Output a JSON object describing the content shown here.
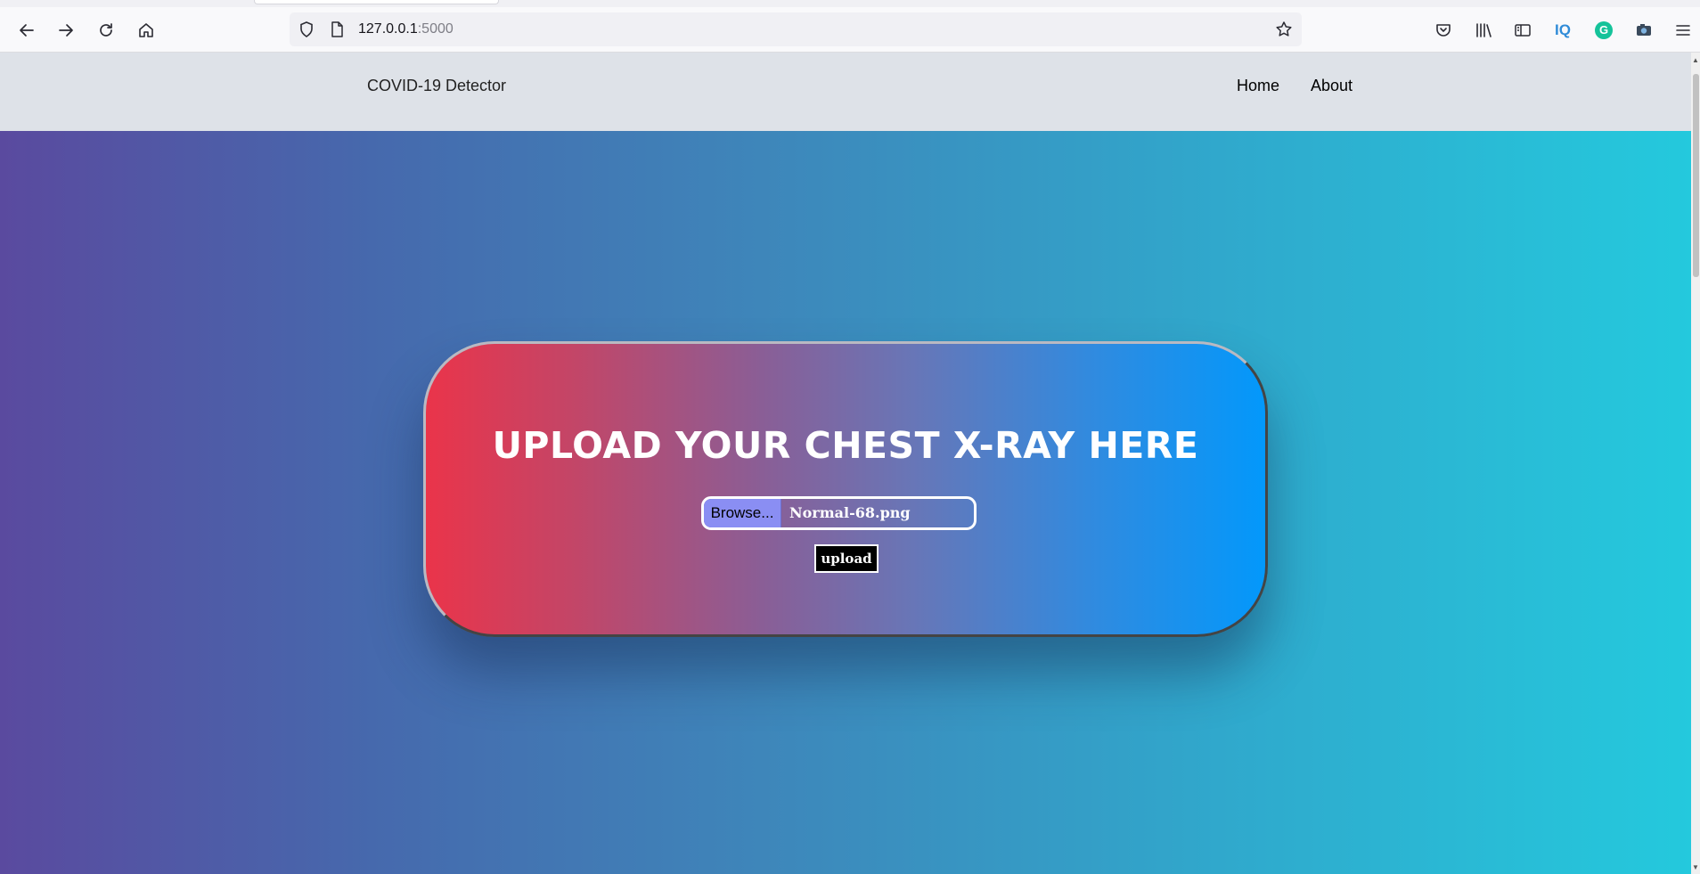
{
  "browser": {
    "url_host": "127.0.0.1",
    "url_port": ":5000",
    "icons": [
      "back-arrow-icon",
      "forward-arrow-icon",
      "reload-icon",
      "home-icon",
      "shield-icon",
      "page-icon",
      "star-icon",
      "pocket-icon",
      "library-icon",
      "sidebar-icon",
      "iq-icon",
      "grammarly-icon",
      "camera-icon",
      "hamburger-menu-icon"
    ],
    "iq_label": "IQ",
    "grammarly_label": "G"
  },
  "navbar": {
    "brand": "COVID-19 Detector",
    "links": [
      "Home",
      "About"
    ]
  },
  "card": {
    "title": "UPLOAD YOUR CHEST X-RAY HERE",
    "browse_label": "Browse...",
    "file_name": "Normal-68.png",
    "upload_label": "upload"
  },
  "colors": {
    "hero_gradient": [
      "#5a4a9f",
      "#24c9dd"
    ],
    "card_gradient": [
      "#ea344a",
      "#0398fb"
    ],
    "browse_button": "#8a8ef3",
    "navbar": "#dee2e8"
  }
}
